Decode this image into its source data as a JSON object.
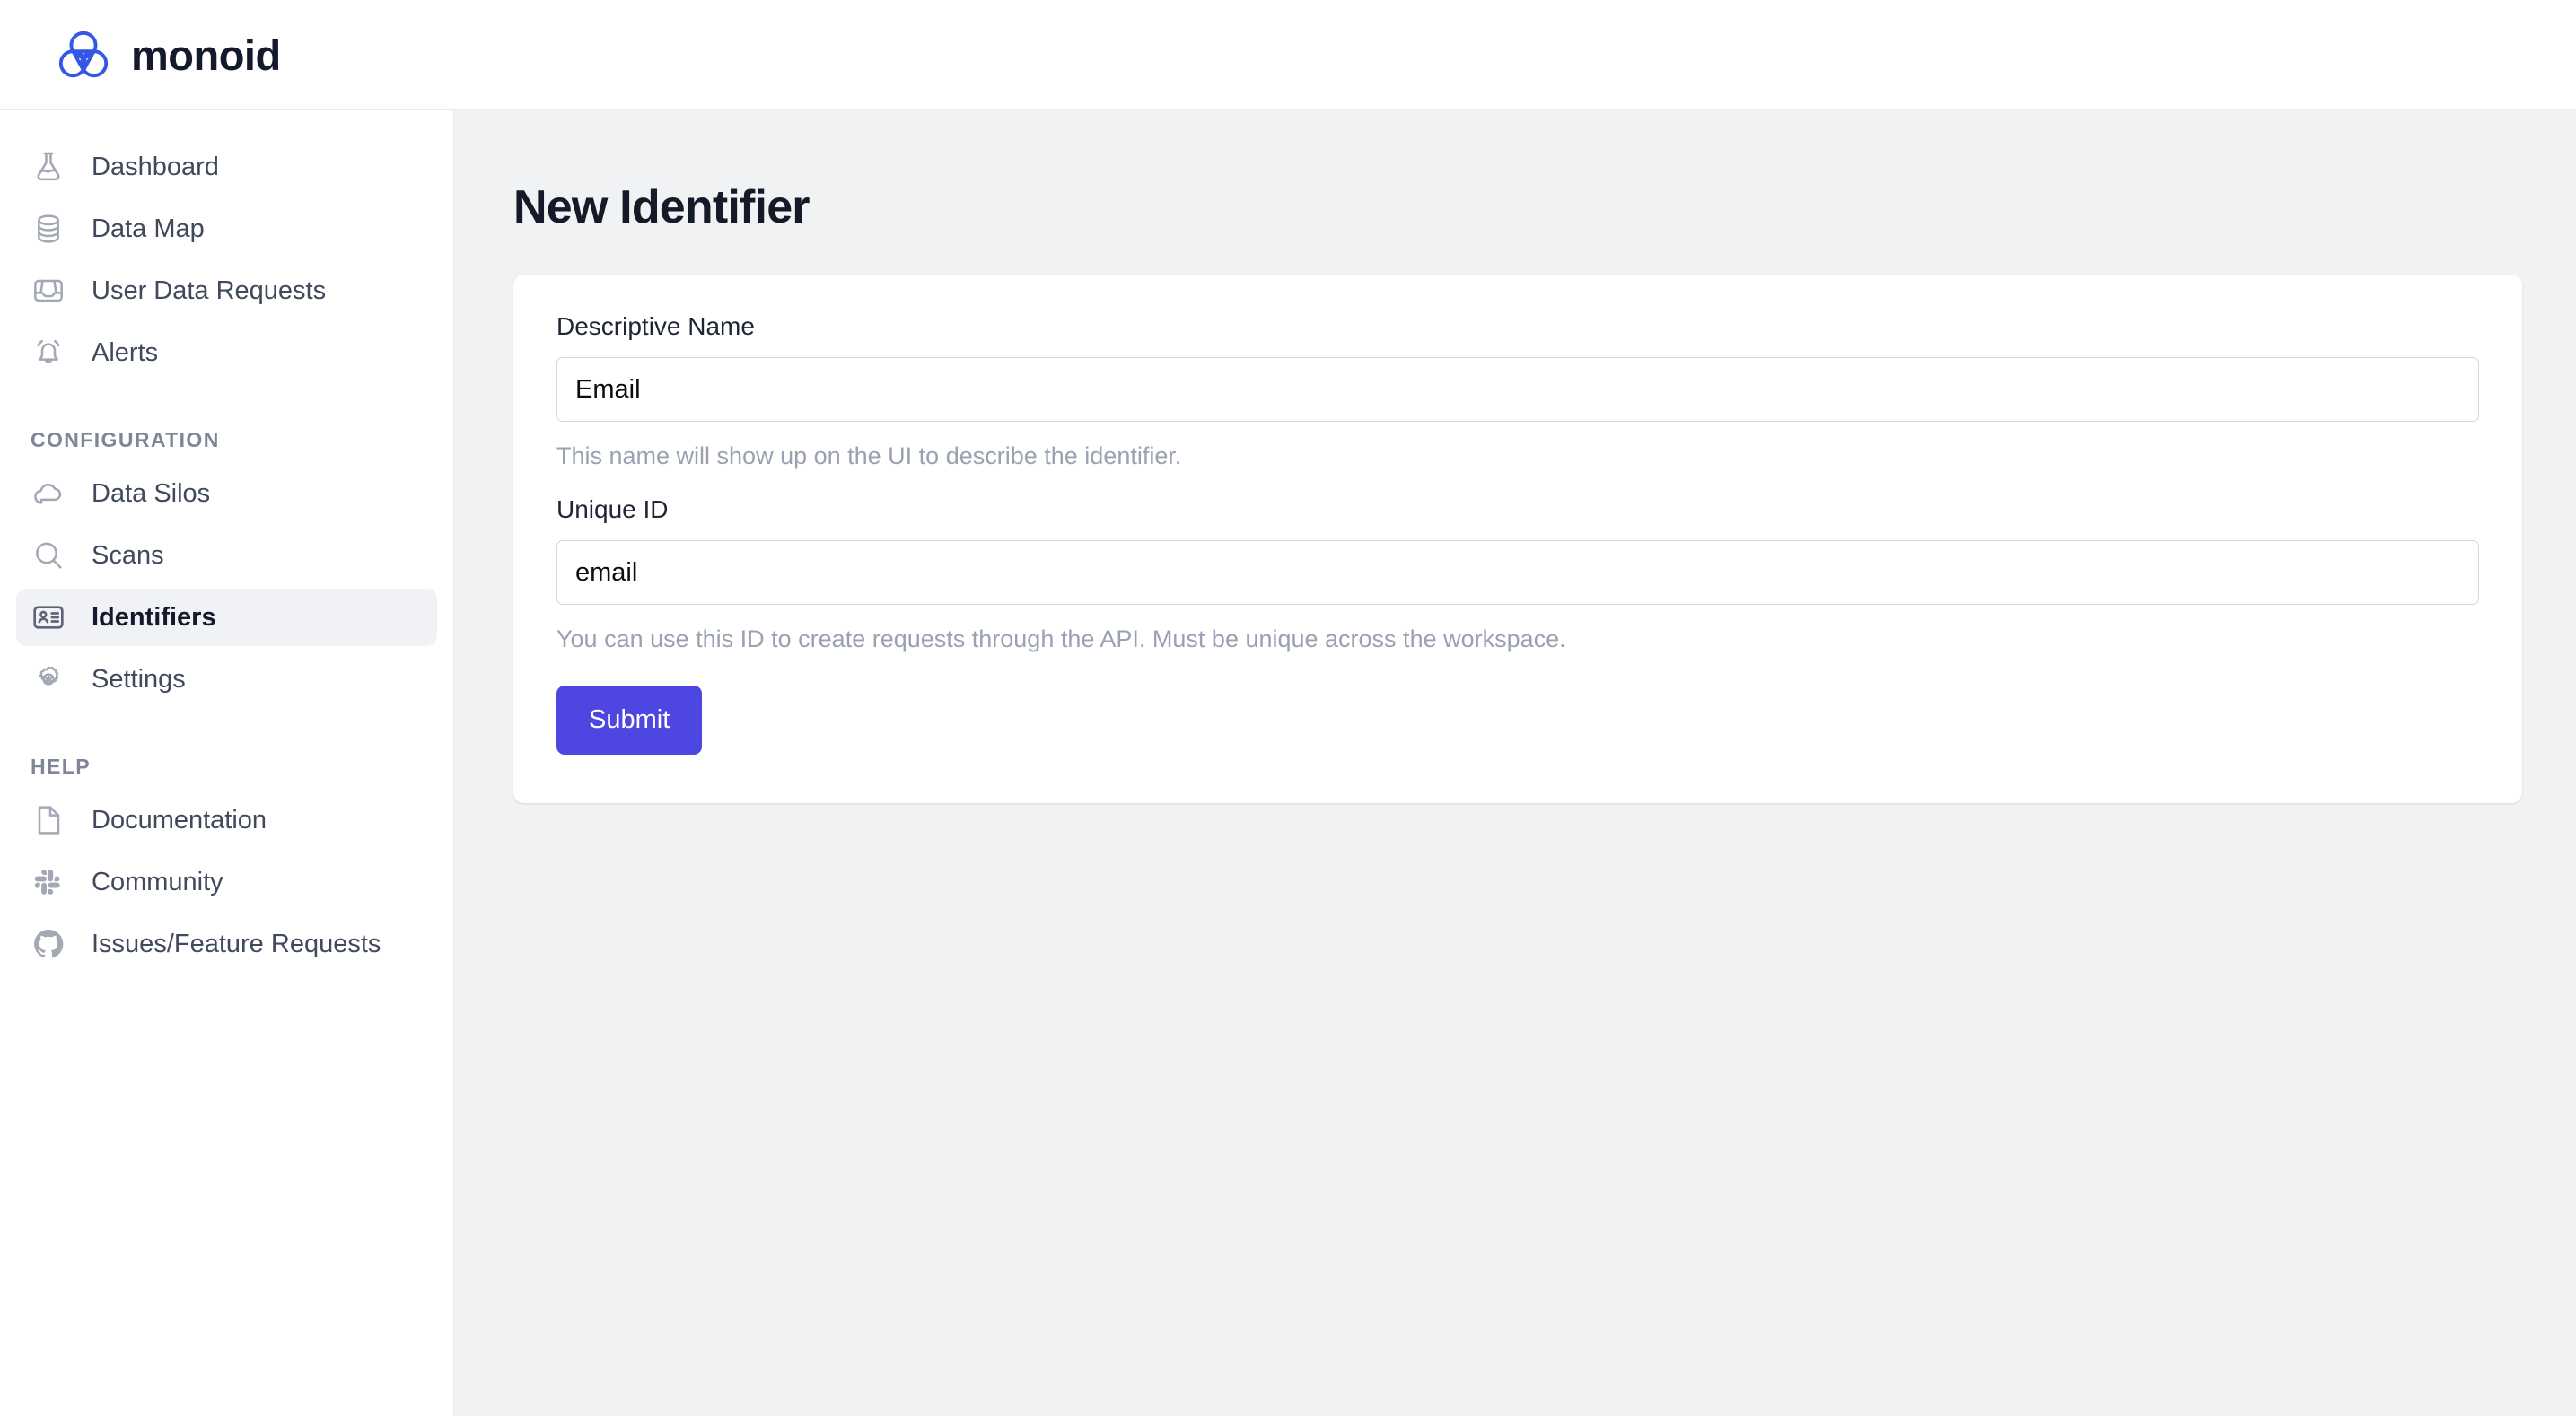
{
  "brand": {
    "name": "monoid",
    "logo_icon": "monoid-trefoil-logo",
    "logo_color": "#3457e8",
    "wordmark_color": "#131a2c"
  },
  "sidebar": {
    "primary_items": [
      {
        "label": "Dashboard",
        "icon": "flask-icon",
        "active": false
      },
      {
        "label": "Data Map",
        "icon": "database-icon",
        "active": false
      },
      {
        "label": "User Data Requests",
        "icon": "inbox-icon",
        "active": false
      },
      {
        "label": "Alerts",
        "icon": "bell-icon",
        "active": false
      }
    ],
    "configuration_section_label": "CONFIGURATION",
    "configuration_items": [
      {
        "label": "Data Silos",
        "icon": "cloud-icon",
        "active": false
      },
      {
        "label": "Scans",
        "icon": "search-icon",
        "active": false
      },
      {
        "label": "Identifiers",
        "icon": "id-card-icon",
        "active": true
      },
      {
        "label": "Settings",
        "icon": "gear-icon",
        "active": false
      }
    ],
    "help_section_label": "HELP",
    "help_items": [
      {
        "label": "Documentation",
        "icon": "document-icon",
        "active": false
      },
      {
        "label": "Community",
        "icon": "slack-icon",
        "active": false
      },
      {
        "label": "Issues/Feature Requests",
        "icon": "github-icon",
        "active": false
      }
    ],
    "active_item_background": "#f1f2f5"
  },
  "main": {
    "page_title": "New Identifier",
    "form": {
      "descriptive_name": {
        "label": "Descriptive Name",
        "value": "Email",
        "placeholder": "Descriptive Name",
        "helper": "This name will show up on the UI to describe the identifier."
      },
      "unique_id": {
        "label": "Unique ID",
        "value": "email",
        "placeholder": "Unique ID",
        "helper": "You can use this ID to create requests through the API. Must be unique across the workspace."
      },
      "submit_label": "Submit",
      "submit_color": "#4d46e0"
    }
  },
  "colors": {
    "page_background": "#f1f2f4",
    "panel_background": "#ffffff",
    "border": "#e8e9ed",
    "input_border": "#d4d7de",
    "muted_text": "#9aa1b1",
    "icon": "#a2a8b4"
  }
}
